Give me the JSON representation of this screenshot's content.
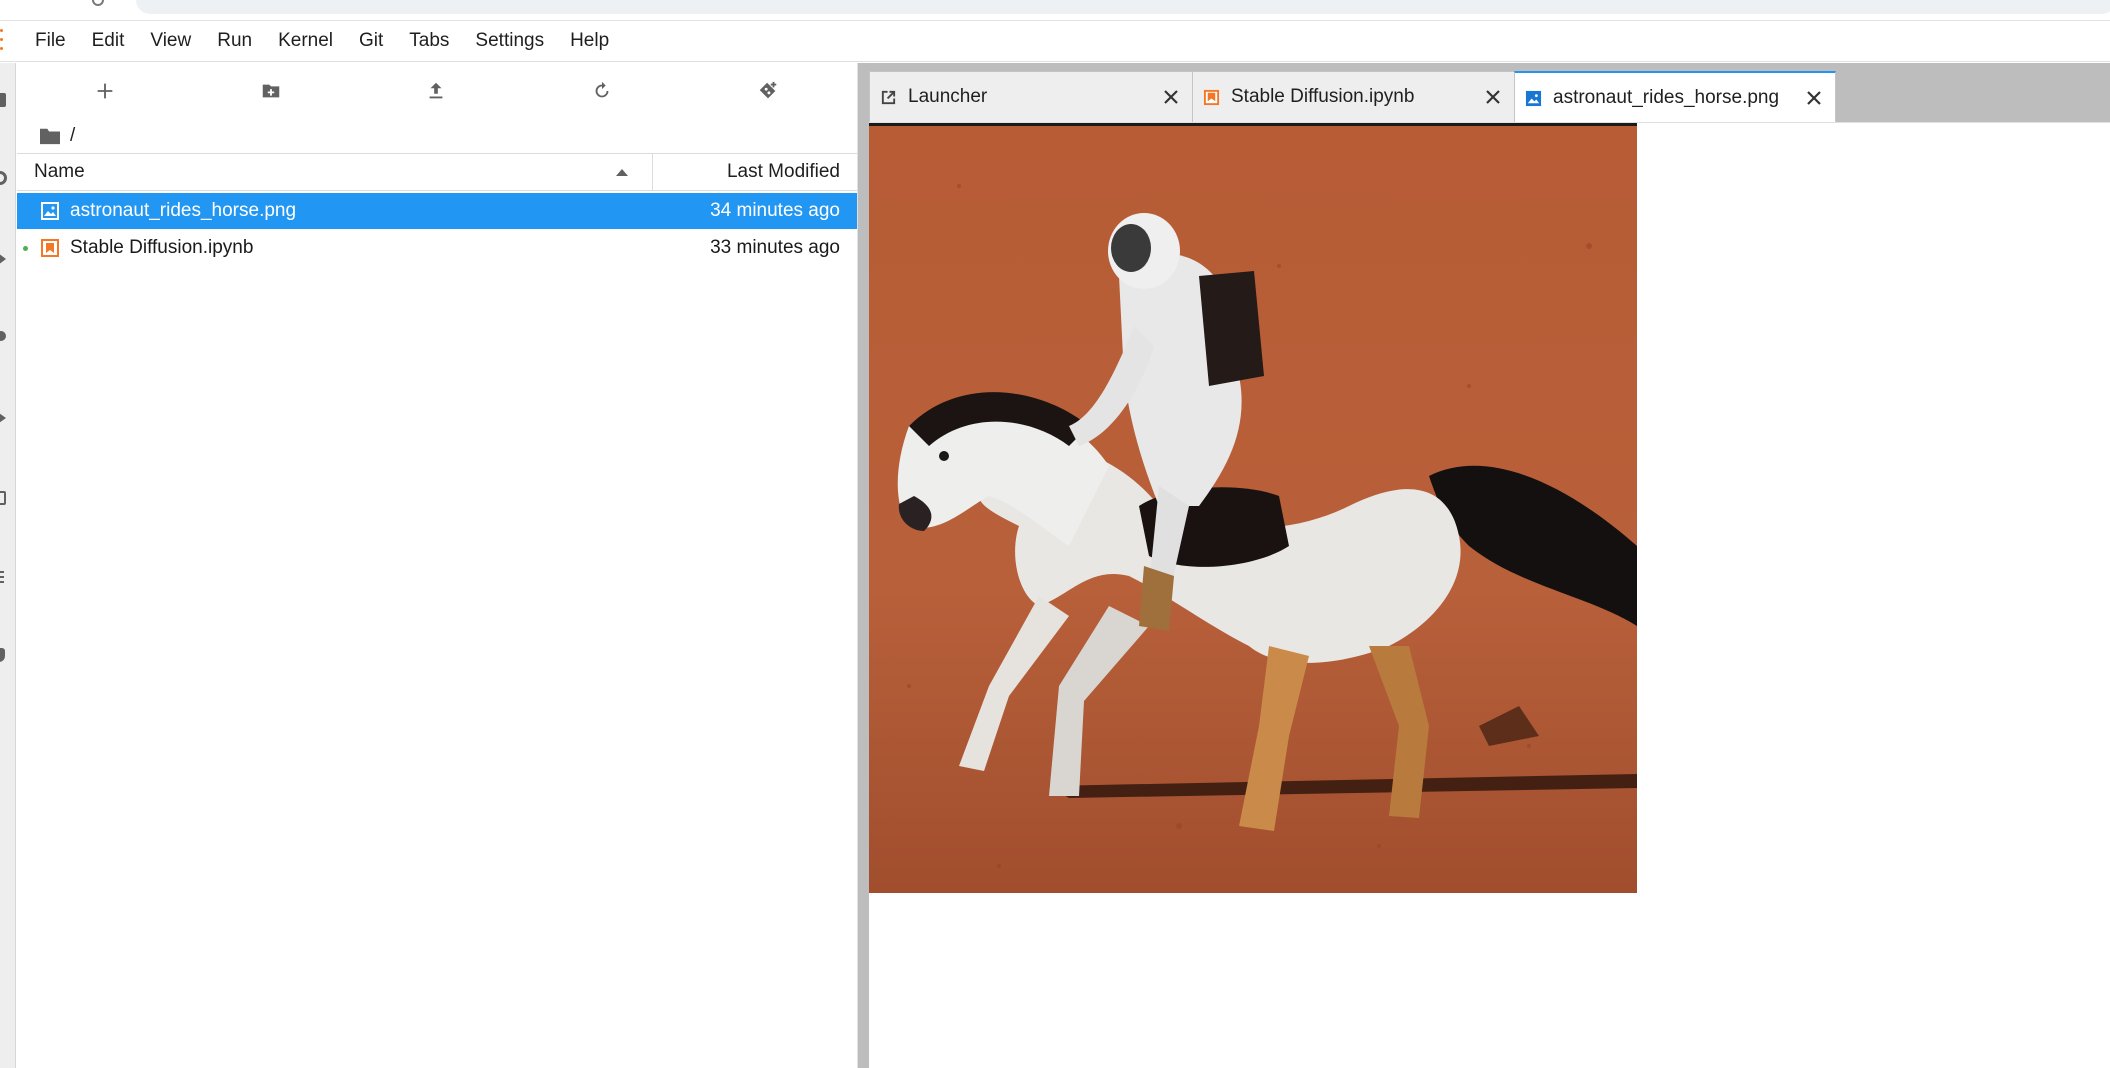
{
  "menubar": {
    "items": [
      "File",
      "Edit",
      "View",
      "Run",
      "Kernel",
      "Git",
      "Tabs",
      "Settings",
      "Help"
    ]
  },
  "toolbar": {
    "buttons": [
      {
        "name": "new-launcher",
        "icon": "plus-icon"
      },
      {
        "name": "new-folder",
        "icon": "folder-plus-icon"
      },
      {
        "name": "upload",
        "icon": "upload-icon"
      },
      {
        "name": "refresh",
        "icon": "refresh-icon"
      },
      {
        "name": "git-clone",
        "icon": "git-clone-icon"
      }
    ]
  },
  "breadcrumb": {
    "path": "/"
  },
  "file_list": {
    "columns": {
      "name": "Name",
      "modified": "Last Modified"
    },
    "files": [
      {
        "name": "astronaut_rides_horse.png",
        "modified": "34 minutes ago",
        "type": "image",
        "selected": true,
        "running": false
      },
      {
        "name": "Stable Diffusion.ipynb",
        "modified": "33 minutes ago",
        "type": "notebook",
        "selected": false,
        "running": true
      }
    ]
  },
  "tabs": [
    {
      "label": "Launcher",
      "icon": "launcher-icon",
      "active": false
    },
    {
      "label": "Stable Diffusion.ipynb",
      "icon": "notebook-icon",
      "active": false
    },
    {
      "label": "astronaut_rides_horse.png",
      "icon": "image-icon",
      "active": true
    }
  ],
  "colors": {
    "selection": "#2196f3",
    "notebook_icon": "#f37726",
    "image_icon": "#1976d2",
    "running_dot": "#4caf50"
  }
}
